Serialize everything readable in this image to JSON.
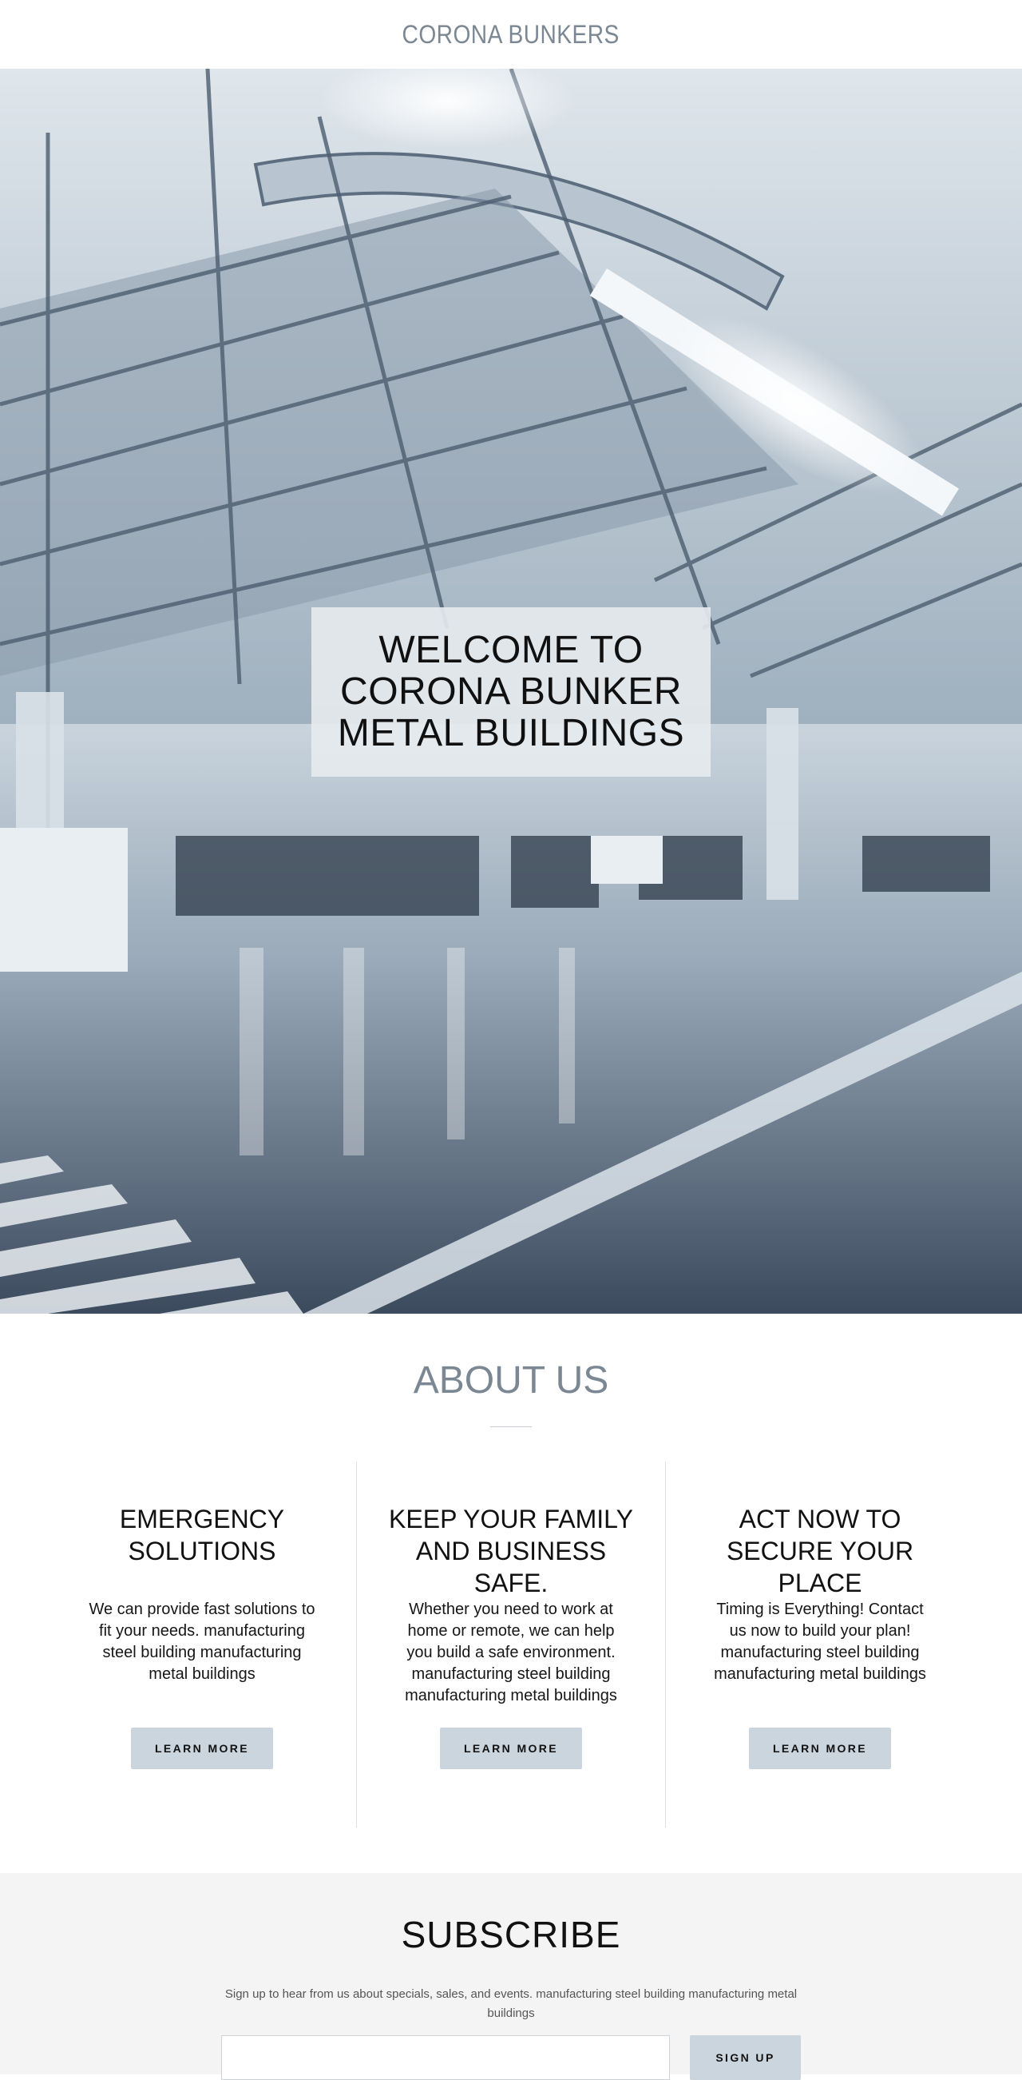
{
  "header": {
    "site_title": "CORONA BUNKERS"
  },
  "hero": {
    "heading": "WELCOME TO CORONA BUNKER METAL BUILDINGS",
    "image_description_icon": "factory-interior-photo"
  },
  "about": {
    "title": "ABOUT US",
    "columns": [
      {
        "title": "EMERGENCY SOLUTIONS",
        "text": "We can provide fast solutions to fit your needs. manufacturing steel building manufacturing metal buildings",
        "button_label": "LEARN MORE"
      },
      {
        "title": "KEEP YOUR FAMILY AND BUSINESS SAFE.",
        "text": "Whether you need to work at home or remote, we can help you build a safe environment. manufacturing steel building manufacturing metal buildings",
        "button_label": "LEARN MORE"
      },
      {
        "title": "ACT NOW TO SECURE YOUR PLACE",
        "text": "Timing is Everything! Contact us now to build your plan! manufacturing steel building manufacturing metal buildings",
        "button_label": "LEARN MORE"
      }
    ]
  },
  "subscribe": {
    "title": "SUBSCRIBE",
    "text": "Sign up to hear from us about specials, sales, and events. manufacturing steel building manufacturing metal buildings",
    "email_value": "",
    "button_label": "SIGN UP"
  },
  "colors": {
    "accent_gray": "#7b8893",
    "button_bg": "#cbd5dd",
    "subscribe_bg": "#f4f4f4"
  }
}
